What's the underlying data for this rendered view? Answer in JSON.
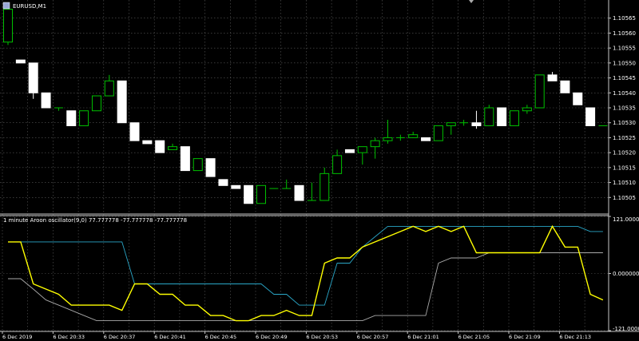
{
  "window": {
    "symbol_title": "EURUSD,M1",
    "indicator_title": "1 minute Aroon oscillator(9,0) 77.777778 -77.777778 -77.777778"
  },
  "colors": {
    "background": "#000000",
    "grid": "#5a5a5a",
    "axis": "#c8c8c8",
    "text": "#ffffff",
    "bull_body": "#000000",
    "bull_border": "#00c000",
    "bear_body": "#ffffff",
    "bear_border": "#ffffff",
    "doji": "#00c000",
    "oscillator": "#ffff00",
    "aroon_up": "#2aa7c8",
    "aroon_down": "#aaaaaa"
  },
  "chart_data": [
    {
      "type": "candlestick",
      "title": "EURUSD,M1",
      "ylim": [
        1.105,
        1.1057
      ],
      "y_ticks": [
        "1.10565",
        "1.10560",
        "1.10555",
        "1.10550",
        "1.10545",
        "1.10540",
        "1.10535",
        "1.10530",
        "1.10525",
        "1.10520",
        "1.10515",
        "1.10510",
        "1.10505"
      ],
      "candles": [
        [
          1.10557,
          1.10568,
          1.10556,
          1.10568
        ],
        [
          1.10551,
          1.10551,
          1.1055,
          1.1055
        ],
        [
          1.1055,
          1.1055,
          1.10538,
          1.1054
        ],
        [
          1.1054,
          1.1054,
          1.10535,
          1.10535
        ],
        [
          1.10535,
          1.10535,
          1.10534,
          1.10535
        ],
        [
          1.10534,
          1.10534,
          1.10529,
          1.10529
        ],
        [
          1.10529,
          1.10534,
          1.10529,
          1.10534
        ],
        [
          1.10534,
          1.10539,
          1.10534,
          1.10539
        ],
        [
          1.10539,
          1.10546,
          1.10539,
          1.10544
        ],
        [
          1.10544,
          1.10544,
          1.1053,
          1.1053
        ],
        [
          1.1053,
          1.1053,
          1.10524,
          1.10524
        ],
        [
          1.10524,
          1.10524,
          1.10523,
          1.10523
        ],
        [
          1.10524,
          1.10524,
          1.1052,
          1.1052
        ],
        [
          1.10521,
          1.10523,
          1.10521,
          1.10522
        ],
        [
          1.10522,
          1.10522,
          1.10514,
          1.10514
        ],
        [
          1.10514,
          1.10518,
          1.10514,
          1.10518
        ],
        [
          1.10518,
          1.10518,
          1.10512,
          1.10512
        ],
        [
          1.10511,
          1.10511,
          1.10509,
          1.10509
        ],
        [
          1.10509,
          1.10509,
          1.10508,
          1.10508
        ],
        [
          1.10509,
          1.10509,
          1.10503,
          1.10503
        ],
        [
          1.10503,
          1.10509,
          1.10503,
          1.10509
        ],
        [
          1.10508,
          1.10508,
          1.10508,
          1.10508
        ],
        [
          1.10508,
          1.10511,
          1.10508,
          1.10508
        ],
        [
          1.10509,
          1.10509,
          1.10504,
          1.10504
        ],
        [
          1.10504,
          1.1051,
          1.10504,
          1.10504
        ],
        [
          1.10504,
          1.10515,
          1.10504,
          1.10513
        ],
        [
          1.10513,
          1.10521,
          1.10513,
          1.10519
        ],
        [
          1.10521,
          1.10521,
          1.1052,
          1.1052
        ],
        [
          1.1052,
          1.10522,
          1.10516,
          1.10522
        ],
        [
          1.10522,
          1.10525,
          1.10518,
          1.10524
        ],
        [
          1.10524,
          1.10531,
          1.10523,
          1.10525
        ],
        [
          1.10525,
          1.10526,
          1.10524,
          1.10525
        ],
        [
          1.10525,
          1.10527,
          1.10525,
          1.10526
        ],
        [
          1.10525,
          1.10525,
          1.10524,
          1.10524
        ],
        [
          1.10524,
          1.10529,
          1.10524,
          1.10529
        ],
        [
          1.10529,
          1.1053,
          1.10526,
          1.1053
        ],
        [
          1.1053,
          1.10531,
          1.10529,
          1.1053
        ],
        [
          1.1053,
          1.10534,
          1.10528,
          1.10529
        ],
        [
          1.10529,
          1.10536,
          1.10529,
          1.10535
        ],
        [
          1.10535,
          1.10535,
          1.10529,
          1.10529
        ],
        [
          1.10529,
          1.10534,
          1.10529,
          1.10534
        ],
        [
          1.10534,
          1.10536,
          1.10533,
          1.10535
        ],
        [
          1.10535,
          1.10546,
          1.10535,
          1.10546
        ],
        [
          1.10546,
          1.10547,
          1.10544,
          1.10544
        ],
        [
          1.10544,
          1.10544,
          1.1054,
          1.1054
        ],
        [
          1.1054,
          1.1054,
          1.10536,
          1.10536
        ],
        [
          1.10535,
          1.10535,
          1.10529,
          1.10529
        ],
        [
          1.10529,
          1.10529,
          1.10529,
          1.10529
        ]
      ]
    },
    {
      "type": "line",
      "title": "1 minute Aroon oscillator(9,0) 77.777778 -77.777778 -77.777778",
      "ylim": [
        -121,
        121
      ],
      "y_ticks": [
        "121.000000",
        "0.000000",
        "-121.000000"
      ],
      "x_ticks": [
        "6 Dec 2019",
        "6 Dec 20:33",
        "6 Dec 20:37",
        "6 Dec 20:41",
        "6 Dec 20:45",
        "6 Dec 20:49",
        "6 Dec 20:53",
        "6 Dec 20:57",
        "6 Dec 21:01",
        "6 Dec 21:05",
        "6 Dec 21:09",
        "6 Dec 21:13"
      ],
      "series": [
        {
          "color": "#ffff00",
          "values": [
            67,
            67,
            -22,
            -33,
            -44,
            -67,
            -67,
            -67,
            -67,
            -78,
            -22,
            -22,
            -44,
            -44,
            -67,
            -67,
            -89,
            -89,
            -100,
            -100,
            -89,
            -89,
            -78,
            -89,
            -89,
            22,
            33,
            33,
            56,
            67,
            78,
            89,
            100,
            89,
            100,
            89,
            100,
            44,
            44,
            44,
            44,
            44,
            44,
            100,
            56,
            56,
            -44,
            -56
          ]
        },
        {
          "color": "#2aa7c8",
          "values": [
            67,
            67,
            67,
            67,
            67,
            67,
            67,
            67,
            67,
            67,
            -22,
            -22,
            -22,
            -22,
            -22,
            -22,
            -22,
            -22,
            -22,
            -22,
            -22,
            -44,
            -44,
            -67,
            -67,
            -67,
            22,
            22,
            56,
            78,
            100,
            100,
            100,
            100,
            100,
            100,
            100,
            100,
            100,
            100,
            100,
            100,
            100,
            100,
            100,
            100,
            89,
            89
          ]
        },
        {
          "color": "#aaaaaa",
          "values": [
            -11,
            -11,
            -33,
            -56,
            -67,
            -78,
            -89,
            -100,
            -100,
            -100,
            -100,
            -100,
            -100,
            -100,
            -100,
            -100,
            -100,
            -100,
            -100,
            -100,
            -100,
            -100,
            -100,
            -100,
            -100,
            -100,
            -100,
            -100,
            -100,
            -89,
            -89,
            -89,
            -89,
            -89,
            22,
            33,
            33,
            33,
            44,
            44,
            44,
            44,
            44,
            44,
            44,
            44,
            44,
            44
          ]
        }
      ]
    }
  ]
}
